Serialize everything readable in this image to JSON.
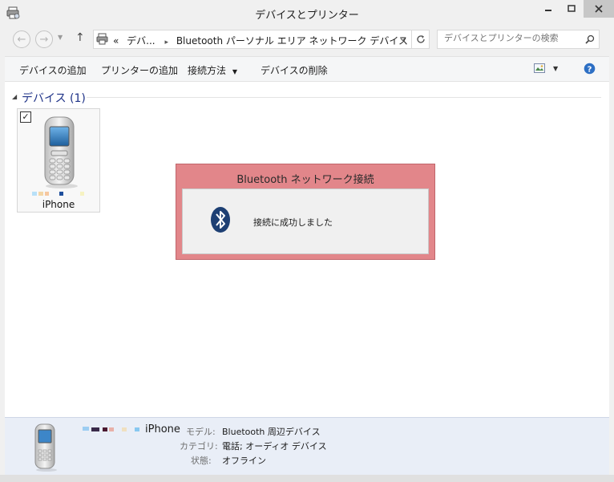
{
  "window": {
    "title": "デバイスとプリンター"
  },
  "nav": {
    "breadcrumb_prefix": "«",
    "breadcrumb_parent": "デバ...",
    "breadcrumb_sep": "▸",
    "breadcrumb_current": "Bluetooth パーソナル エリア ネットワーク デバイス",
    "search_placeholder": "デバイスとプリンターの検索"
  },
  "commands": {
    "add_device": "デバイスの追加",
    "add_printer": "プリンターの追加",
    "connect_using": "接続方法",
    "remove_device": "デバイスの削除"
  },
  "group": {
    "header": "デバイス (1)"
  },
  "device": {
    "name": "iPhone",
    "checked": true
  },
  "toast": {
    "title": "Bluetooth ネットワーク接続",
    "message": "接続に成功しました"
  },
  "details": {
    "name": "iPhone",
    "model_label": "モデル:",
    "model_value": "Bluetooth 周辺デバイス",
    "category_label": "カテゴリ:",
    "category_value": "電話; オーディオ デバイス",
    "status_label": "状態:",
    "status_value": "オフライン"
  },
  "icons": {
    "app": "devices-printers-icon",
    "back": "back-arrow-icon",
    "forward": "forward-arrow-icon",
    "up": "up-arrow-icon",
    "refresh": "refresh-icon",
    "search": "search-icon",
    "bluetooth": "bluetooth-icon",
    "help": "help-icon",
    "view": "change-view-icon",
    "phone": "phone-icon"
  },
  "colors": {
    "toast_border": "#e2868a",
    "header_text": "#1e3287",
    "details_bg": "#e9eef7"
  }
}
